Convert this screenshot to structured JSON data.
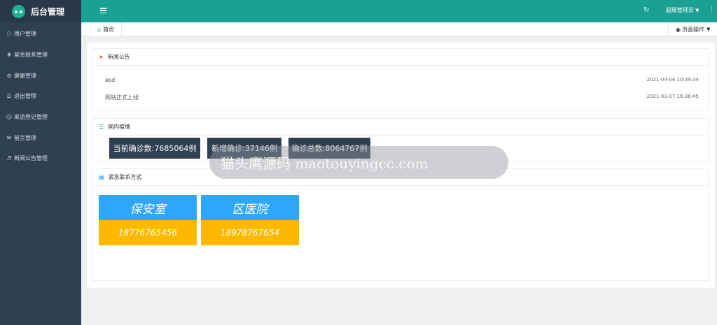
{
  "app": {
    "title": "后台管理"
  },
  "sidebar": {
    "items": [
      {
        "label": "用户管理",
        "icon": "users-icon"
      },
      {
        "label": "紧急联系管理",
        "icon": "cubes-icon"
      },
      {
        "label": "健康管理",
        "icon": "cogs-icon"
      },
      {
        "label": "进出管理",
        "icon": "list-icon"
      },
      {
        "label": "来访登记管理",
        "icon": "user-plus-icon"
      },
      {
        "label": "留言管理",
        "icon": "comments-icon"
      },
      {
        "label": "新闻公告管理",
        "icon": "volume-icon"
      }
    ]
  },
  "header": {
    "user": "超级管理员"
  },
  "tabs": {
    "home": "首页",
    "page_ops": "页面操作"
  },
  "news": {
    "title": "新闻公告",
    "items": [
      {
        "title": "asd",
        "time": "2021-04-04 10:39:34"
      },
      {
        "title": "网站正式上线",
        "time": "2021-03-07 16:36:45"
      }
    ]
  },
  "epidemic": {
    "title": "国内疫情",
    "stats": [
      "当前确诊数:7685064例",
      "新增确诊:37146例",
      "确诊总数:8064767例"
    ]
  },
  "contacts": {
    "title": "紧急联系方式",
    "items": [
      {
        "name": "保安室",
        "phone": "18776765456"
      },
      {
        "name": "区医院",
        "phone": "18978767654"
      }
    ]
  },
  "watermark": "猫头鹰源码 maotouyingcc.com",
  "colors": {
    "sidebar": "#2f4050",
    "header": "#1aa094",
    "blue": "#2da6ff",
    "yellow": "#ffb800"
  }
}
